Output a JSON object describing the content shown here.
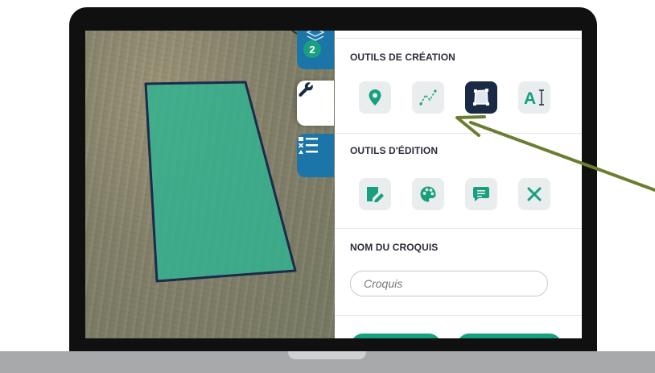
{
  "tabs": {
    "layers_badge": "2"
  },
  "panel": {
    "creation": {
      "title": "OUTILS DE CRÉATION",
      "tools": [
        {
          "name": "point-marker-icon",
          "active": false
        },
        {
          "name": "line-draw-icon",
          "active": false
        },
        {
          "name": "polygon-draw-icon",
          "active": true
        },
        {
          "name": "text-tool-icon",
          "active": false
        }
      ]
    },
    "edition": {
      "title": "OUTILS D'ÉDITION",
      "tools": [
        {
          "name": "edit-shape-icon"
        },
        {
          "name": "color-palette-icon"
        },
        {
          "name": "comment-icon"
        },
        {
          "name": "delete-x-icon"
        }
      ]
    },
    "sketch_name": {
      "title": "NOM DU CROQUIS",
      "placeholder": "Croquis",
      "value": ""
    }
  },
  "colors": {
    "tab_blue": "#1c75a8",
    "accent_green": "#19a07f",
    "field_fill": "#2fb390",
    "field_outline": "#1d2a4a",
    "active_tool_bg": "#1b2a44",
    "annotation_arrow": "#6b7d31"
  }
}
